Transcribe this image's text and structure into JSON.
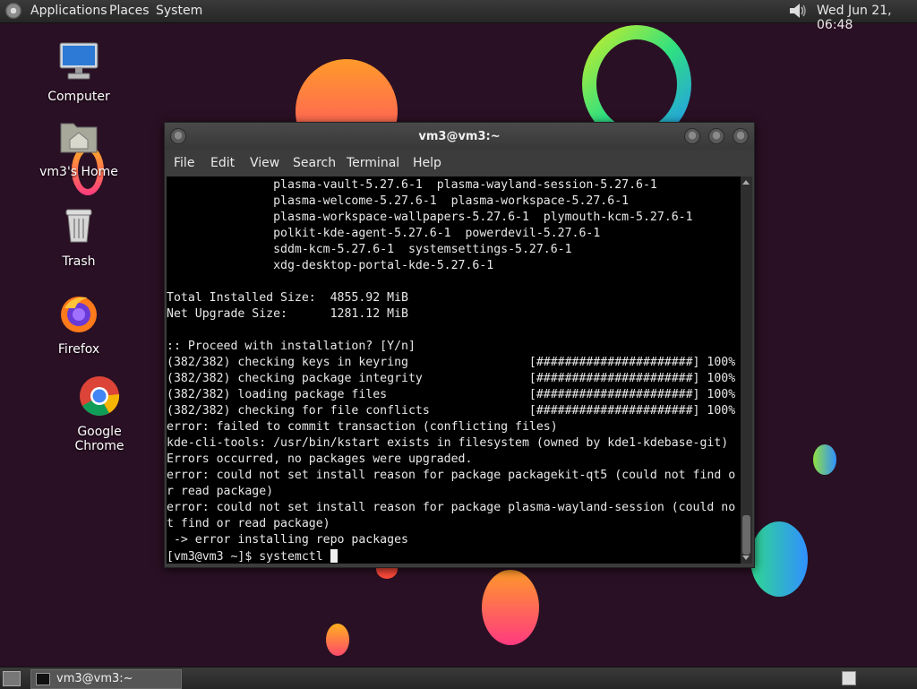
{
  "top_panel": {
    "menus": [
      "Applications",
      "Places",
      "System"
    ],
    "clock": "Wed Jun 21, 06:48",
    "icons": [
      "gnome-foot-icon",
      "volume-icon"
    ]
  },
  "desktop_icons": [
    {
      "label": "Computer",
      "icon": "computer-icon"
    },
    {
      "label": "vm3's Home",
      "icon": "home-folder-icon"
    },
    {
      "label": "Trash",
      "icon": "trash-icon"
    },
    {
      "label": "Firefox",
      "icon": "firefox-icon"
    },
    {
      "label": "Google Chrome",
      "icon": "chrome-icon"
    }
  ],
  "terminal": {
    "title": "vm3@vm3:~",
    "menu": [
      "File",
      "Edit",
      "View",
      "Search",
      "Terminal",
      "Help"
    ],
    "lines": [
      "               plasma-vault-5.27.6-1  plasma-wayland-session-5.27.6-1",
      "               plasma-welcome-5.27.6-1  plasma-workspace-5.27.6-1",
      "               plasma-workspace-wallpapers-5.27.6-1  plymouth-kcm-5.27.6-1",
      "               polkit-kde-agent-5.27.6-1  powerdevil-5.27.6-1",
      "               sddm-kcm-5.27.6-1  systemsettings-5.27.6-1",
      "               xdg-desktop-portal-kde-5.27.6-1",
      "",
      "Total Installed Size:  4855.92 MiB",
      "Net Upgrade Size:      1281.12 MiB",
      "",
      ":: Proceed with installation? [Y/n]",
      "(382/382) checking keys in keyring                 [######################] 100%",
      "(382/382) checking package integrity               [######################] 100%",
      "(382/382) loading package files                    [######################] 100%",
      "(382/382) checking for file conflicts              [######################] 100%",
      "error: failed to commit transaction (conflicting files)",
      "kde-cli-tools: /usr/bin/kstart exists in filesystem (owned by kde1-kdebase-git)",
      "Errors occurred, no packages were upgraded.",
      "error: could not set install reason for package packagekit-qt5 (could not find o",
      "r read package)",
      "error: could not set install reason for package plasma-wayland-session (could no",
      "t find or read package)",
      " -> error installing repo packages"
    ],
    "prompt": "[vm3@vm3 ~]$ systemctl "
  },
  "bottom_panel": {
    "task_label": "vm3@vm3:~"
  },
  "colors": {
    "desktop_bg": "#2a1024",
    "terminal_bg": "#000000",
    "terminal_fg": "#e8e8e8",
    "panel_bg": "#2e2e2e"
  }
}
